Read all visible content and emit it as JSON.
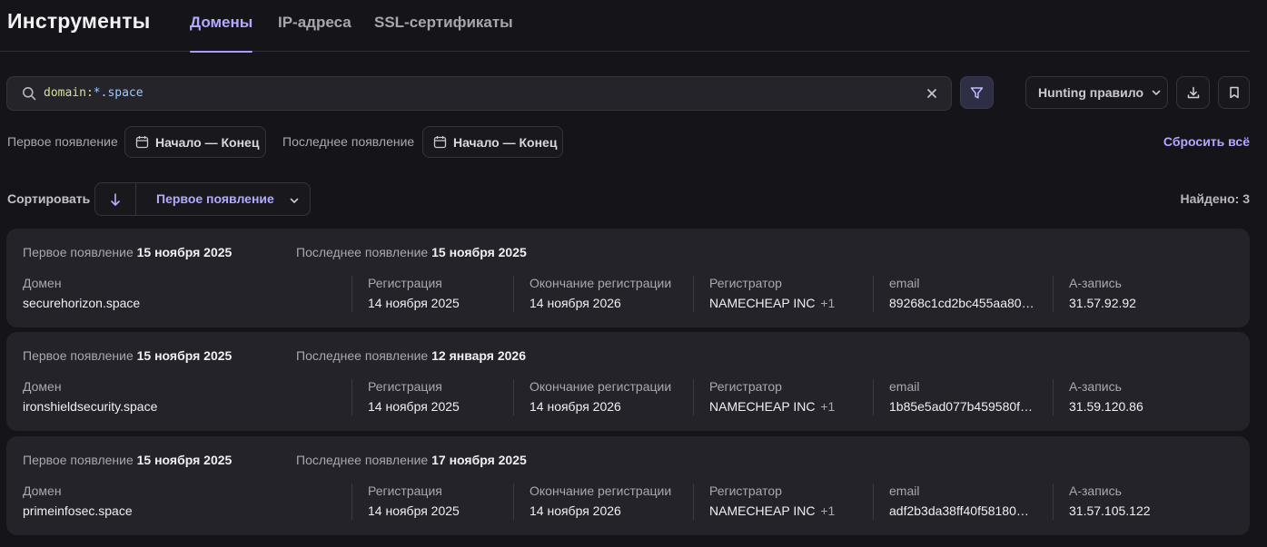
{
  "header": {
    "title": "Инструменты",
    "tabs": [
      {
        "label": "Домены",
        "active": true
      },
      {
        "label": "IP-адреса",
        "active": false
      },
      {
        "label": "SSL-сертификаты",
        "active": false
      }
    ]
  },
  "search": {
    "query_key": "domain:",
    "query_value": "*.space"
  },
  "toolbar": {
    "hunting_label": "Hunting правило"
  },
  "filters": {
    "first_seen_label": "Первое появление",
    "first_seen_range": "Начало — Конец",
    "last_seen_label": "Последнее появление",
    "last_seen_range": "Начало — Конец",
    "reset_label": "Сбросить всё"
  },
  "sort": {
    "label": "Сортировать",
    "field": "Первое появление",
    "found": "Найдено: 3"
  },
  "columns": {
    "first_seen": "Первое появление",
    "last_seen": "Последнее появление",
    "domain": "Домен",
    "registration": "Регистрация",
    "expiration": "Окончание регистрации",
    "registrar": "Регистратор",
    "email": "email",
    "a_record": "A-запись"
  },
  "results": [
    {
      "first_seen": "15 ноября 2025",
      "last_seen": "15 ноября 2025",
      "domain": "securehorizon.space",
      "registration": "14 ноября 2025",
      "expiration": "14 ноября 2026",
      "registrar": "NAMECHEAP INC",
      "registrar_more": "+1",
      "email": "89268c1cd2bc455aa80…",
      "a_record": "31.57.92.92"
    },
    {
      "first_seen": "15 ноября 2025",
      "last_seen": "12 января 2026",
      "domain": "ironshieldsecurity.space",
      "registration": "14 ноября 2025",
      "expiration": "14 ноября 2026",
      "registrar": "NAMECHEAP INC",
      "registrar_more": "+1",
      "email": "1b85e5ad077b459580f…",
      "a_record": "31.59.120.86"
    },
    {
      "first_seen": "15 ноября 2025",
      "last_seen": "17 ноября 2025",
      "domain": "primeinfosec.space",
      "registration": "14 ноября 2025",
      "expiration": "14 ноября 2026",
      "registrar": "NAMECHEAP INC",
      "registrar_more": "+1",
      "email": "adf2b3da38ff40f58180…",
      "a_record": "31.57.105.122"
    }
  ],
  "colors": {
    "background": "#141419",
    "card": "#232329",
    "accent": "#b3aaff",
    "query_key": "#d7e08f",
    "query_value": "#9fc9ff"
  },
  "icons": {
    "search": "search-icon",
    "clear": "close-icon",
    "filter": "filter-icon",
    "download": "download-icon",
    "bookmark": "bookmark-icon",
    "calendar": "calendar-icon",
    "sort_direction": "arrow-down-icon",
    "dropdown": "chevron-down-icon"
  }
}
